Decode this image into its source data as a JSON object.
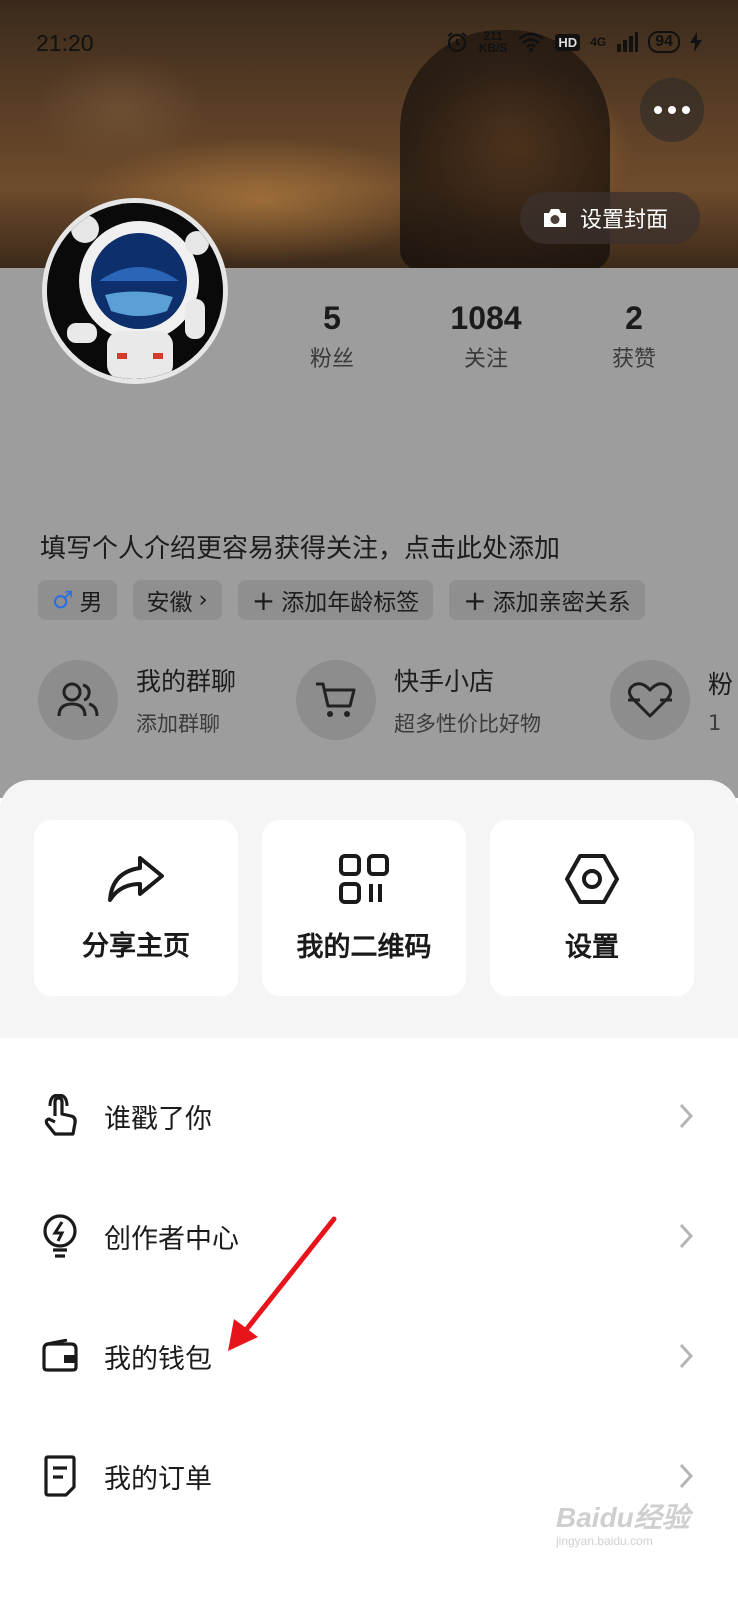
{
  "status_bar": {
    "time": "21:20",
    "net_speed": "211\nKB/S",
    "hd": "HD",
    "signal": "4G",
    "battery": "94"
  },
  "header": {
    "set_cover_label": "设置封面"
  },
  "profile": {
    "stats": [
      {
        "value": "5",
        "label": "粉丝"
      },
      {
        "value": "1084",
        "label": "关注"
      },
      {
        "value": "2",
        "label": "获赞"
      }
    ],
    "bio_prompt": "填写个人介绍更容易获得关注，点击此处添加",
    "tags": {
      "gender": "男",
      "location": "安徽",
      "add_age": "添加年龄标签",
      "add_relation": "添加亲密关系"
    },
    "shortcuts": [
      {
        "title": "我的群聊",
        "subtitle": "添加群聊"
      },
      {
        "title": "快手小店",
        "subtitle": "超多性价比好物"
      },
      {
        "title": "粉",
        "subtitle": "1"
      }
    ]
  },
  "quick_actions": [
    {
      "label": "分享主页",
      "icon": "share-icon"
    },
    {
      "label": "我的二维码",
      "icon": "qrcode-icon"
    },
    {
      "label": "设置",
      "icon": "settings-icon"
    }
  ],
  "menu": [
    {
      "label": "谁戳了你",
      "icon": "tap-hand-icon"
    },
    {
      "label": "创作者中心",
      "icon": "creator-bulb-icon"
    },
    {
      "label": "我的钱包",
      "icon": "wallet-icon"
    },
    {
      "label": "我的订单",
      "icon": "order-icon"
    }
  ],
  "watermark": {
    "brand": "Baidu经验",
    "url": "jingyan.baidu.com"
  },
  "colors": {
    "profile_bg": "#9d9d9d",
    "sheet_bg": "#f5f5f5",
    "annotation_arrow": "#e8141b",
    "gender_icon": "#2d6fe0"
  }
}
